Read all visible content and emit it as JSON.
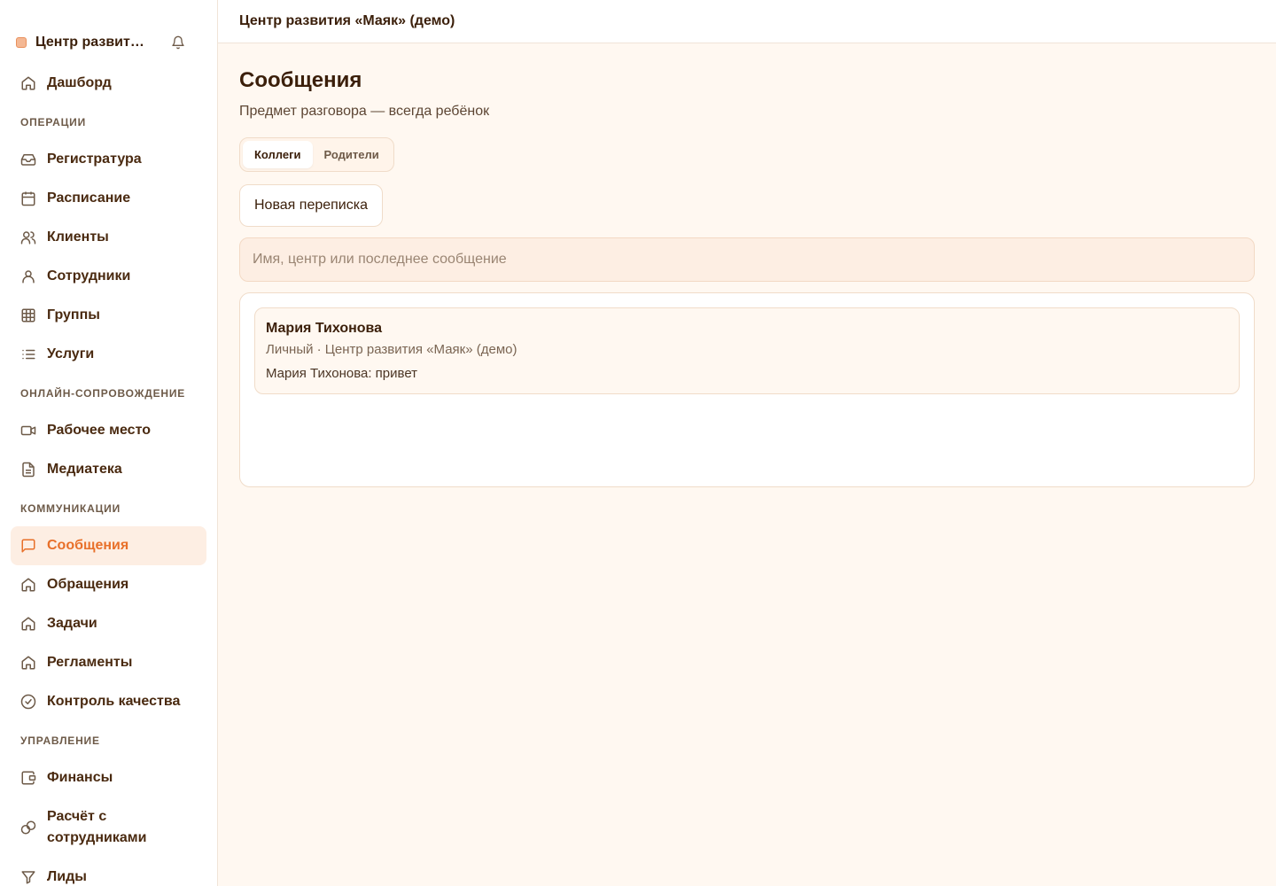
{
  "sidebar": {
    "brand": "Центр развит…",
    "items": {
      "dashboard": "Дашборд",
      "reception": "Регистратура",
      "schedule": "Расписание",
      "clients": "Клиенты",
      "staff": "Сотрудники",
      "groups": "Группы",
      "services": "Услуги",
      "workplace": "Рабочее место",
      "media": "Медиатека",
      "messages": "Сообщения",
      "requests": "Обращения",
      "tasks": "Задачи",
      "regulations": "Регламенты",
      "quality": "Контроль качества",
      "finance": "Финансы",
      "payroll": "Расчёт с сотрудниками",
      "leads": "Лиды"
    },
    "sections": {
      "operations": "ОПЕРАЦИИ",
      "online": "ОНЛАЙН-СОПРОВОЖДЕНИЕ",
      "communications": "КОММУНИКАЦИИ",
      "management": "УПРАВЛЕНИЕ"
    }
  },
  "topbar": {
    "title": "Центр развития «Маяк» (демо)"
  },
  "page": {
    "title": "Сообщения",
    "subtitle": "Предмет разговора — всегда ребёнок",
    "tabs": [
      "Коллеги",
      "Родители"
    ],
    "new_button": "Новая переписка",
    "search_placeholder": "Имя, центр или последнее сообщение"
  },
  "conversations": [
    {
      "name": "Мария Тихонова",
      "meta": "Личный · Центр развития «Маяк» (демо)",
      "last": "Мария Тихонова: привет"
    }
  ],
  "colors": {
    "accent": "#e8702a",
    "active_bg": "#fdeee3",
    "page_bg": "#fff8f1"
  }
}
